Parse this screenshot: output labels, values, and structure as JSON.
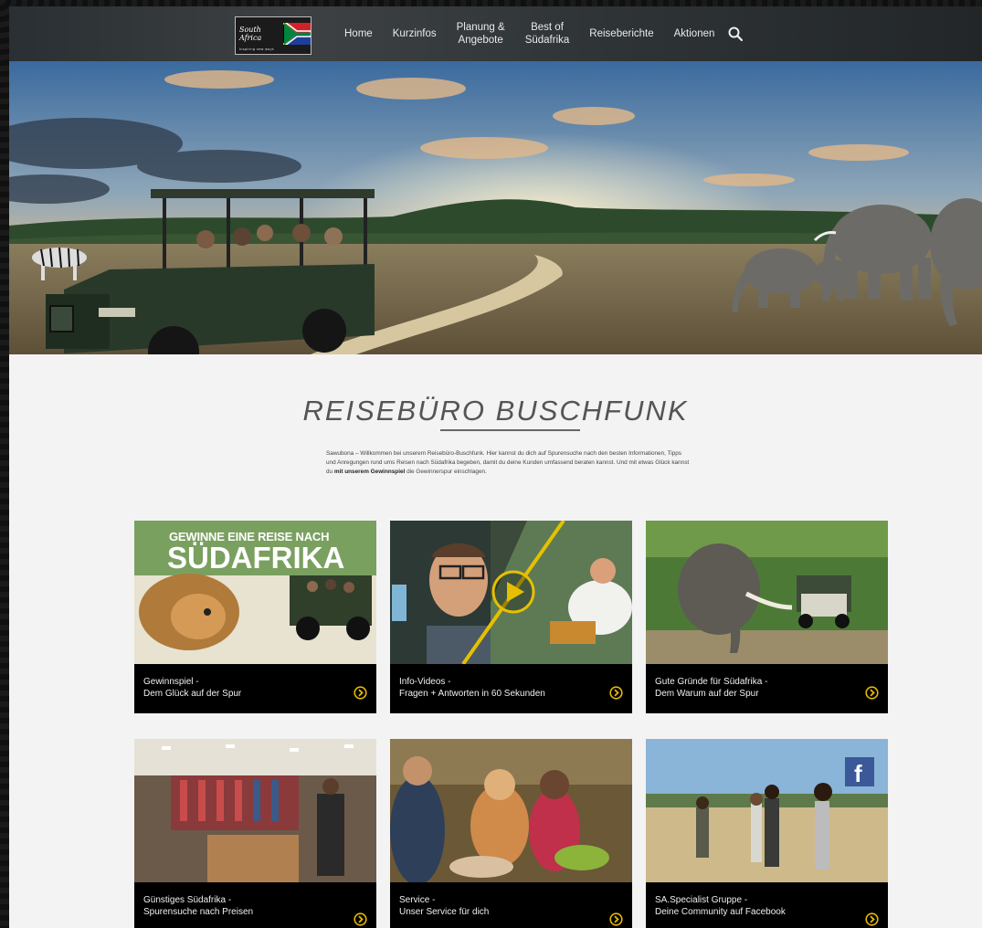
{
  "logo": {
    "script_text": "South Africa",
    "tagline": "Inspiring new ways"
  },
  "nav": {
    "items": [
      {
        "label": "Home"
      },
      {
        "label": "Kurzinfos"
      },
      {
        "label": "Planung &\nAngebote"
      },
      {
        "label": "Best of\nSüdafrika"
      },
      {
        "label": "Reiseberichte"
      },
      {
        "label": "Aktionen"
      }
    ],
    "search_icon": "search-icon"
  },
  "main": {
    "title": "REISEBÜRO BUSCHFUNK",
    "intro_part1": "Sawubona – Willkommen bei unserem Reisebüro-Buschfunk. Hier kannst du dich auf Spurensuche nach den besten Informationen, Tipps und Anregungen rund ums Reisen nach Südafrika begeben, damit du deine Kunden umfassend beraten kannst. Und mit etwas Glück kannst du ",
    "intro_bold": "mit unserem Gewinnspiel",
    "intro_part2": " die Gewinnerspur einschlagen."
  },
  "tiles": [
    {
      "line1": "Gewinnspiel -",
      "line2": "Dem Glück auf der Spur",
      "overlay_line1": "GEWINNE EINE REISE NACH",
      "overlay_line2": "SÜDAFRIKA"
    },
    {
      "line1": "Info-Videos -",
      "line2": "Fragen + Antworten in 60 Sekunden"
    },
    {
      "line1": "Gute Gründe für Südafrika -",
      "line2": "Dem Warum auf der Spur"
    },
    {
      "line1": "Günstiges Südafrika -",
      "line2": "Spurensuche nach Preisen"
    },
    {
      "line1": "Service -",
      "line2": "Unser Service für dich"
    },
    {
      "line1": "SA.Specialist Gruppe -",
      "line2": "Deine Community auf Facebook"
    }
  ],
  "colors": {
    "accent_yellow": "#e6b800",
    "caption_bg": "#000000",
    "page_bg": "#f3f3f3"
  }
}
